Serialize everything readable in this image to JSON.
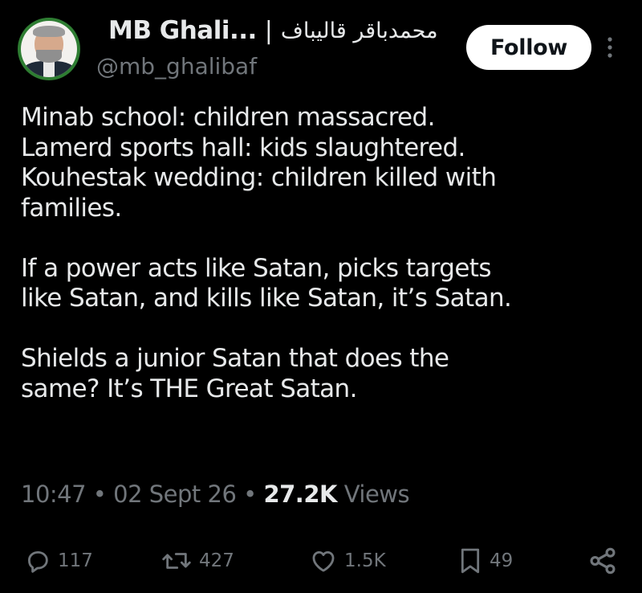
{
  "author": {
    "display_name": "MB Ghali...",
    "separator": "|",
    "display_name_persian": "محمدباقر قالیباف",
    "handle": "@mb_ghalibaf"
  },
  "follow_button": {
    "label": "Follow"
  },
  "tweet": {
    "paragraphs": [
      {
        "lines": [
          "Minab school: children massacred.",
          "Lamerd sports hall: kids slaughtered.",
          "Kouhestak wedding: children killed with",
          "families."
        ]
      },
      {
        "lines": [
          "If a power acts like Satan, picks targets",
          "like Satan, and kills like Satan, it’s Satan."
        ]
      },
      {
        "lines": [
          "Shields a junior Satan that does the",
          "same? It’s THE Great Satan."
        ]
      }
    ]
  },
  "meta": {
    "time": "10:47",
    "dot": "•",
    "date": "02 Sept 26",
    "views_count": "27.2K",
    "views_label": "Views"
  },
  "actions": {
    "replies": "117",
    "reposts": "427",
    "likes": "1.5K",
    "bookmarks": "49"
  },
  "icons": {
    "more": "more-vertical-icon",
    "reply": "reply-icon",
    "repost": "repost-icon",
    "like": "heart-icon",
    "bookmark": "bookmark-icon",
    "share": "share-icon"
  },
  "colors": {
    "background": "#000000",
    "text_primary": "#e7e9ea",
    "text_secondary": "#71767b",
    "follow_bg": "#ffffff",
    "follow_text": "#0f1419"
  }
}
